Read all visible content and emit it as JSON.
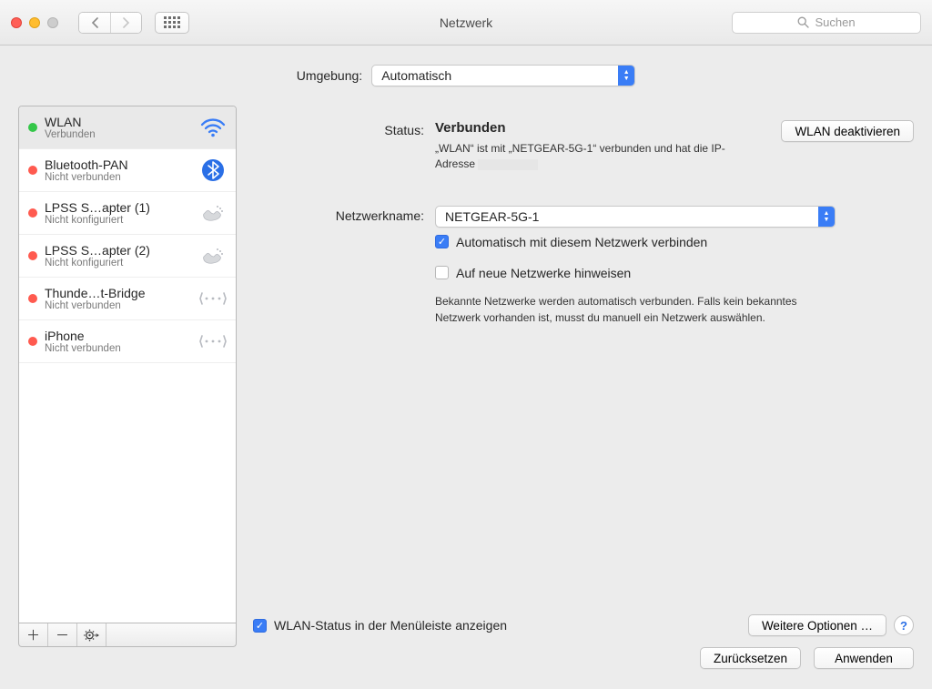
{
  "window_title": "Netzwerk",
  "search_placeholder": "Suchen",
  "location": {
    "label": "Umgebung:",
    "value": "Automatisch"
  },
  "interfaces": [
    {
      "name": "WLAN",
      "status": "Verbunden",
      "dot": "green",
      "icon": "wifi",
      "selected": true
    },
    {
      "name": "Bluetooth-PAN",
      "status": "Nicht verbunden",
      "dot": "red",
      "icon": "bluetooth",
      "selected": false
    },
    {
      "name": "LPSS S…apter (1)",
      "status": "Nicht konfiguriert",
      "dot": "red",
      "icon": "phone",
      "selected": false
    },
    {
      "name": "LPSS S…apter (2)",
      "status": "Nicht konfiguriert",
      "dot": "red",
      "icon": "phone",
      "selected": false
    },
    {
      "name": "Thunde…t-Bridge",
      "status": "Nicht verbunden",
      "dot": "red",
      "icon": "bridge",
      "selected": false
    },
    {
      "name": "iPhone",
      "status": "Nicht verbunden",
      "dot": "red",
      "icon": "bridge",
      "selected": false
    }
  ],
  "detail": {
    "status_label": "Status:",
    "status_value": "Verbunden",
    "toggle_button": "WLAN deaktivieren",
    "status_desc_1": "„WLAN“ ist mit „NETGEAR-5G-1“ verbunden und hat die IP-",
    "status_desc_2": "Adresse",
    "network_name_label": "Netzwerkname:",
    "network_name_value": "NETGEAR-5G-1",
    "auto_connect_label": "Automatisch mit diesem Netzwerk verbinden",
    "new_networks_label": "Auf neue Netzwerke hinweisen",
    "new_networks_help": "Bekannte Netzwerke werden automatisch verbunden. Falls kein bekanntes Netzwerk vorhanden ist, musst du manuell ein Netzwerk auswählen.",
    "show_status_label": "WLAN-Status in der Menüleiste anzeigen",
    "more_options_button": "Weitere Optionen …"
  },
  "footer": {
    "reset": "Zurücksetzen",
    "apply": "Anwenden"
  }
}
